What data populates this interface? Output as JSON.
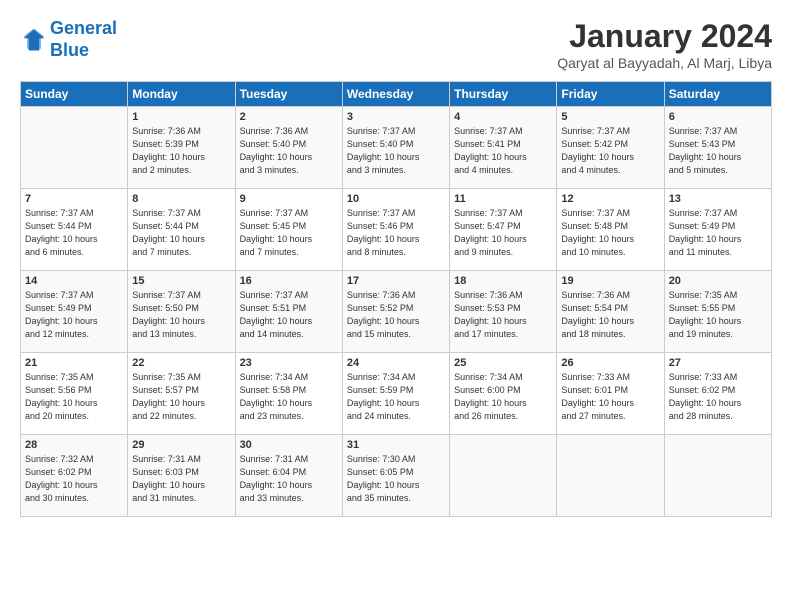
{
  "header": {
    "logo_line1": "General",
    "logo_line2": "Blue",
    "title": "January 2024",
    "subtitle": "Qaryat al Bayyadah, Al Marj, Libya"
  },
  "days_of_week": [
    "Sunday",
    "Monday",
    "Tuesday",
    "Wednesday",
    "Thursday",
    "Friday",
    "Saturday"
  ],
  "weeks": [
    [
      {
        "num": "",
        "info": ""
      },
      {
        "num": "1",
        "info": "Sunrise: 7:36 AM\nSunset: 5:39 PM\nDaylight: 10 hours\nand 2 minutes."
      },
      {
        "num": "2",
        "info": "Sunrise: 7:36 AM\nSunset: 5:40 PM\nDaylight: 10 hours\nand 3 minutes."
      },
      {
        "num": "3",
        "info": "Sunrise: 7:37 AM\nSunset: 5:40 PM\nDaylight: 10 hours\nand 3 minutes."
      },
      {
        "num": "4",
        "info": "Sunrise: 7:37 AM\nSunset: 5:41 PM\nDaylight: 10 hours\nand 4 minutes."
      },
      {
        "num": "5",
        "info": "Sunrise: 7:37 AM\nSunset: 5:42 PM\nDaylight: 10 hours\nand 4 minutes."
      },
      {
        "num": "6",
        "info": "Sunrise: 7:37 AM\nSunset: 5:43 PM\nDaylight: 10 hours\nand 5 minutes."
      }
    ],
    [
      {
        "num": "7",
        "info": "Sunrise: 7:37 AM\nSunset: 5:44 PM\nDaylight: 10 hours\nand 6 minutes."
      },
      {
        "num": "8",
        "info": "Sunrise: 7:37 AM\nSunset: 5:44 PM\nDaylight: 10 hours\nand 7 minutes."
      },
      {
        "num": "9",
        "info": "Sunrise: 7:37 AM\nSunset: 5:45 PM\nDaylight: 10 hours\nand 7 minutes."
      },
      {
        "num": "10",
        "info": "Sunrise: 7:37 AM\nSunset: 5:46 PM\nDaylight: 10 hours\nand 8 minutes."
      },
      {
        "num": "11",
        "info": "Sunrise: 7:37 AM\nSunset: 5:47 PM\nDaylight: 10 hours\nand 9 minutes."
      },
      {
        "num": "12",
        "info": "Sunrise: 7:37 AM\nSunset: 5:48 PM\nDaylight: 10 hours\nand 10 minutes."
      },
      {
        "num": "13",
        "info": "Sunrise: 7:37 AM\nSunset: 5:49 PM\nDaylight: 10 hours\nand 11 minutes."
      }
    ],
    [
      {
        "num": "14",
        "info": "Sunrise: 7:37 AM\nSunset: 5:49 PM\nDaylight: 10 hours\nand 12 minutes."
      },
      {
        "num": "15",
        "info": "Sunrise: 7:37 AM\nSunset: 5:50 PM\nDaylight: 10 hours\nand 13 minutes."
      },
      {
        "num": "16",
        "info": "Sunrise: 7:37 AM\nSunset: 5:51 PM\nDaylight: 10 hours\nand 14 minutes."
      },
      {
        "num": "17",
        "info": "Sunrise: 7:36 AM\nSunset: 5:52 PM\nDaylight: 10 hours\nand 15 minutes."
      },
      {
        "num": "18",
        "info": "Sunrise: 7:36 AM\nSunset: 5:53 PM\nDaylight: 10 hours\nand 17 minutes."
      },
      {
        "num": "19",
        "info": "Sunrise: 7:36 AM\nSunset: 5:54 PM\nDaylight: 10 hours\nand 18 minutes."
      },
      {
        "num": "20",
        "info": "Sunrise: 7:35 AM\nSunset: 5:55 PM\nDaylight: 10 hours\nand 19 minutes."
      }
    ],
    [
      {
        "num": "21",
        "info": "Sunrise: 7:35 AM\nSunset: 5:56 PM\nDaylight: 10 hours\nand 20 minutes."
      },
      {
        "num": "22",
        "info": "Sunrise: 7:35 AM\nSunset: 5:57 PM\nDaylight: 10 hours\nand 22 minutes."
      },
      {
        "num": "23",
        "info": "Sunrise: 7:34 AM\nSunset: 5:58 PM\nDaylight: 10 hours\nand 23 minutes."
      },
      {
        "num": "24",
        "info": "Sunrise: 7:34 AM\nSunset: 5:59 PM\nDaylight: 10 hours\nand 24 minutes."
      },
      {
        "num": "25",
        "info": "Sunrise: 7:34 AM\nSunset: 6:00 PM\nDaylight: 10 hours\nand 26 minutes."
      },
      {
        "num": "26",
        "info": "Sunrise: 7:33 AM\nSunset: 6:01 PM\nDaylight: 10 hours\nand 27 minutes."
      },
      {
        "num": "27",
        "info": "Sunrise: 7:33 AM\nSunset: 6:02 PM\nDaylight: 10 hours\nand 28 minutes."
      }
    ],
    [
      {
        "num": "28",
        "info": "Sunrise: 7:32 AM\nSunset: 6:02 PM\nDaylight: 10 hours\nand 30 minutes."
      },
      {
        "num": "29",
        "info": "Sunrise: 7:31 AM\nSunset: 6:03 PM\nDaylight: 10 hours\nand 31 minutes."
      },
      {
        "num": "30",
        "info": "Sunrise: 7:31 AM\nSunset: 6:04 PM\nDaylight: 10 hours\nand 33 minutes."
      },
      {
        "num": "31",
        "info": "Sunrise: 7:30 AM\nSunset: 6:05 PM\nDaylight: 10 hours\nand 35 minutes."
      },
      {
        "num": "",
        "info": ""
      },
      {
        "num": "",
        "info": ""
      },
      {
        "num": "",
        "info": ""
      }
    ]
  ]
}
